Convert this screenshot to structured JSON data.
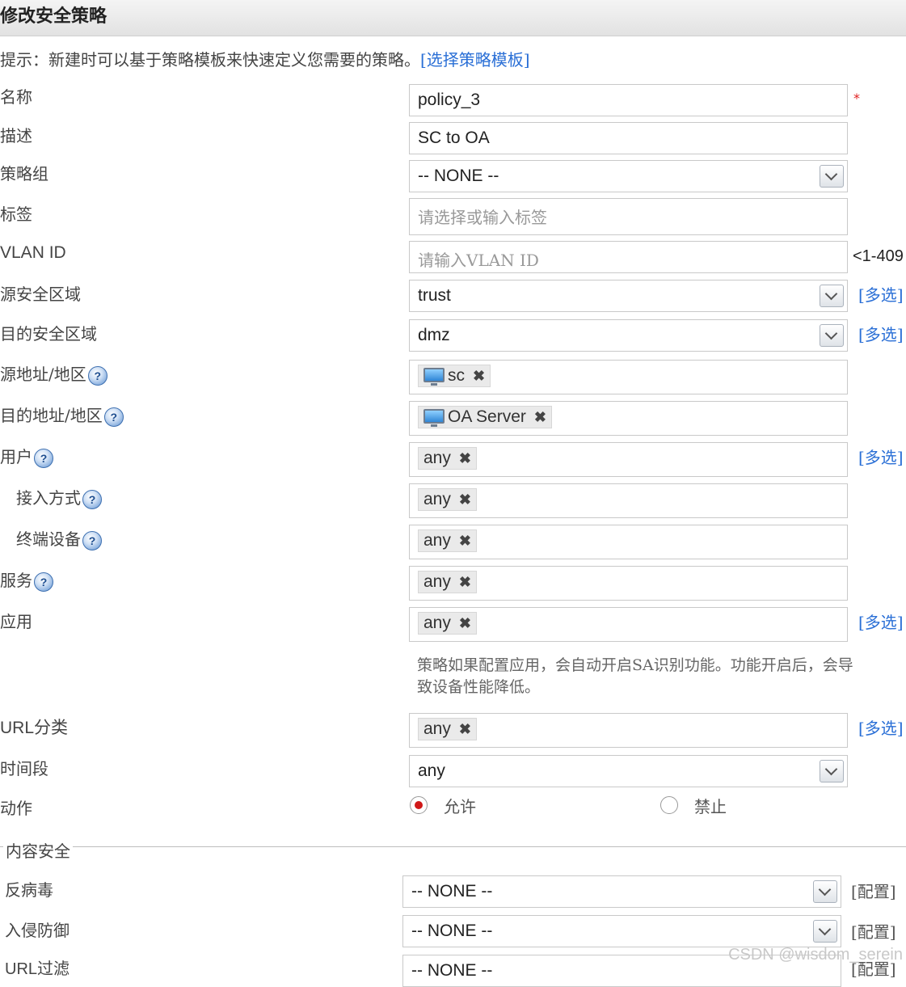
{
  "dialog": {
    "title": "修改安全策略"
  },
  "hint": {
    "text": "提示：新建时可以基于策略模板来快速定义您需要的策略。",
    "link": "[选择策略模板]"
  },
  "form": {
    "name": {
      "label": "名称",
      "value": "policy_3",
      "required": "*"
    },
    "description": {
      "label": "描述",
      "value": "SC to OA"
    },
    "policy_group": {
      "label": "策略组",
      "value": "-- NONE --"
    },
    "tag": {
      "label": "标签",
      "placeholder": "请选择或输入标签"
    },
    "vlan_id": {
      "label": "VLAN ID",
      "placeholder": "请输入VLAN ID",
      "range": "<1-409"
    },
    "src_zone": {
      "label": "源安全区域",
      "value": "trust",
      "multi": "[多选]"
    },
    "dst_zone": {
      "label": "目的安全区域",
      "value": "dmz",
      "multi": "[多选]"
    },
    "src_addr": {
      "label": "源地址/地区",
      "token": "sc",
      "token_icon": "computer-icon"
    },
    "dst_addr": {
      "label": "目的地址/地区",
      "token": "OA Server",
      "token_icon": "computer-icon"
    },
    "user": {
      "label": "用户",
      "token": "any",
      "multi": "[多选]"
    },
    "access_mode": {
      "label": "接入方式",
      "token": "any"
    },
    "terminal": {
      "label": "终端设备",
      "token": "any"
    },
    "service": {
      "label": "服务",
      "token": "any"
    },
    "application": {
      "label": "应用",
      "token": "any",
      "multi": "[多选]",
      "note": "策略如果配置应用，会自动开启SA识别功能。功能开启后，会导致设备性能降低。"
    },
    "url_category": {
      "label": "URL分类",
      "token": "any",
      "multi": "[多选]"
    },
    "time_range": {
      "label": "时间段",
      "value": "any"
    },
    "action": {
      "label": "动作",
      "options": [
        "允许",
        "禁止"
      ],
      "selected": "允许"
    }
  },
  "content_security": {
    "title": "内容安全",
    "antivirus": {
      "label": "反病毒",
      "value": "-- NONE --",
      "config": "[配置]"
    },
    "ips": {
      "label": "入侵防御",
      "value": "-- NONE --",
      "config": "[配置]"
    },
    "url_filter": {
      "label": "URL过滤",
      "value": "-- NONE --",
      "config": "[配置]"
    }
  },
  "token_remove_glyph": "✖",
  "help_glyph": "?",
  "watermark": "CSDN @wisdom_serein",
  "colors": {
    "link": "#2a6fd6",
    "required": "#e02020",
    "radio_selected": "#d01818"
  }
}
